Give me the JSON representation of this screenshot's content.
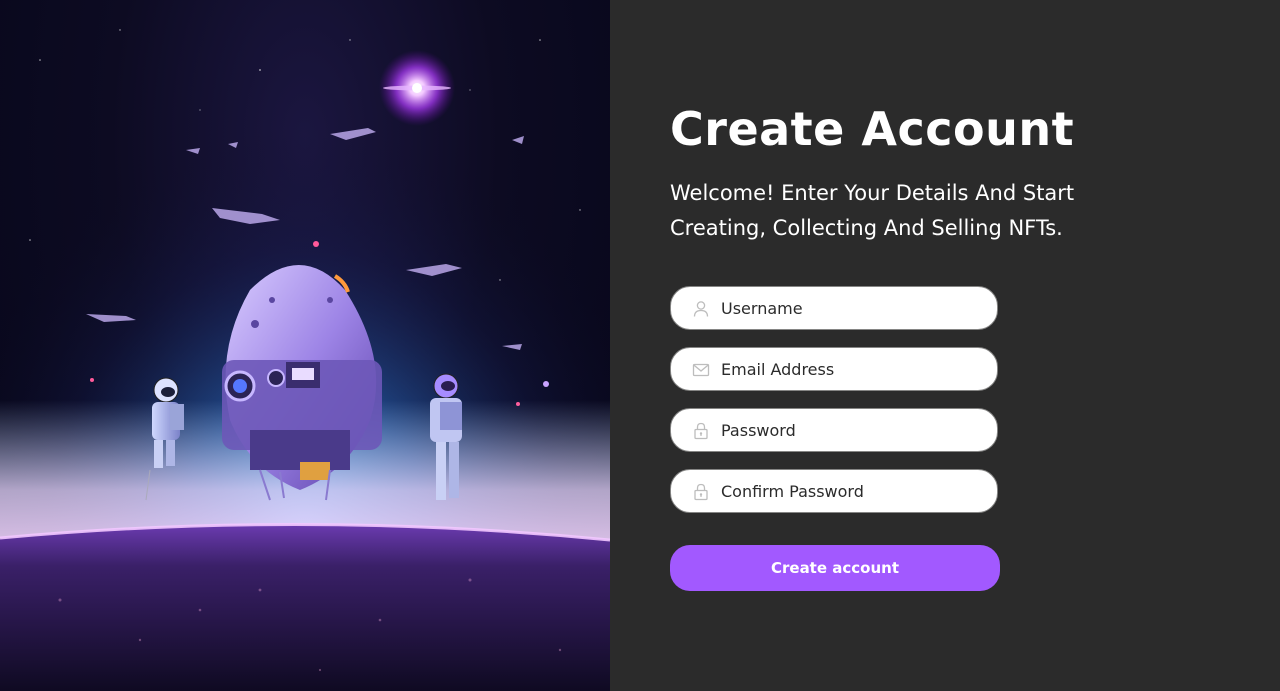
{
  "hero": {
    "icon": "space-illustration",
    "accent": "#a259ff"
  },
  "form": {
    "title": "Create Account",
    "subtitle": "Welcome! Enter Your Details And Start Creating, Collecting And Selling NFTs.",
    "fields": [
      {
        "icon": "user-icon",
        "placeholder": "Username",
        "value": ""
      },
      {
        "icon": "envelope-icon",
        "placeholder": "Email Address",
        "value": ""
      },
      {
        "icon": "lock-icon",
        "placeholder": "Password",
        "value": ""
      },
      {
        "icon": "lock-icon",
        "placeholder": "Confirm Password",
        "value": ""
      }
    ],
    "submit_label": "Create account"
  },
  "colors": {
    "background": "#2b2b2b",
    "accent": "#a259ff",
    "text": "#ffffff",
    "field_border": "#858584"
  }
}
